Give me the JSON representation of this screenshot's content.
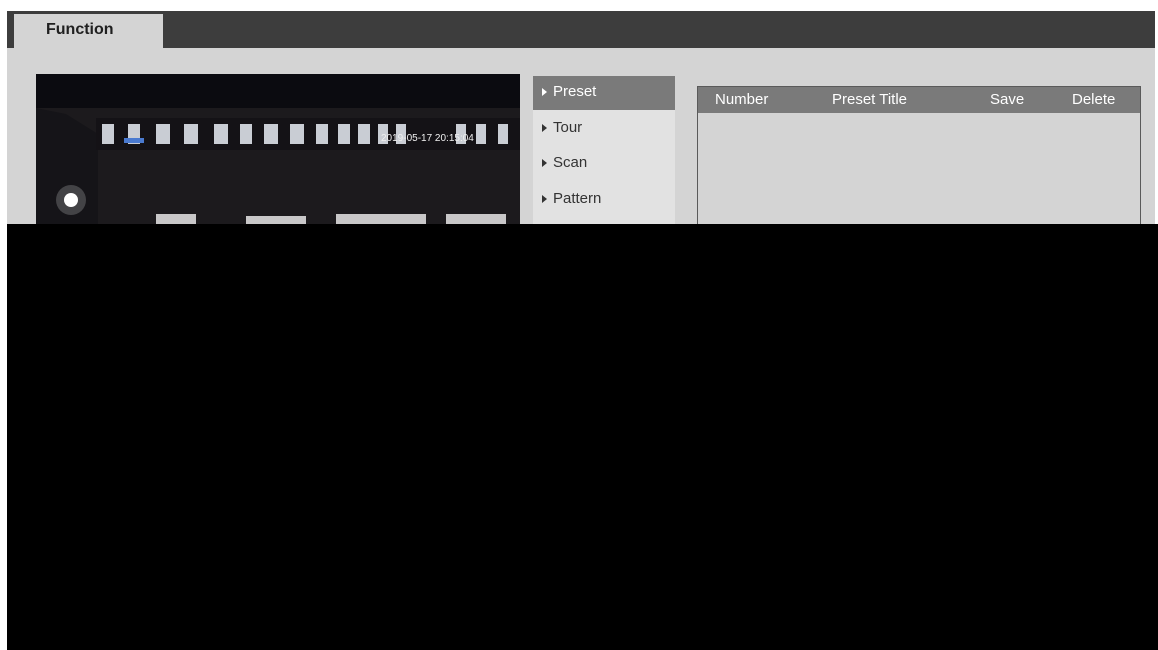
{
  "tabs": {
    "active": "Function"
  },
  "video": {
    "osd_timestamp": "2019-05-17 20:15:04"
  },
  "menu": {
    "items": [
      {
        "label": "Preset",
        "active": true
      },
      {
        "label": "Tour",
        "active": false
      },
      {
        "label": "Scan",
        "active": false
      },
      {
        "label": "Pattern",
        "active": false
      }
    ]
  },
  "preset_table": {
    "columns": [
      "Number",
      "Preset Title",
      "Save",
      "Delete"
    ],
    "rows": []
  },
  "colors": {
    "tab_bar": "#3d3d3d",
    "panel_bg": "#d4d4d4",
    "active_menu": "#7a7a7a",
    "table_header": "#7a7a7a",
    "mask": "#000000"
  }
}
